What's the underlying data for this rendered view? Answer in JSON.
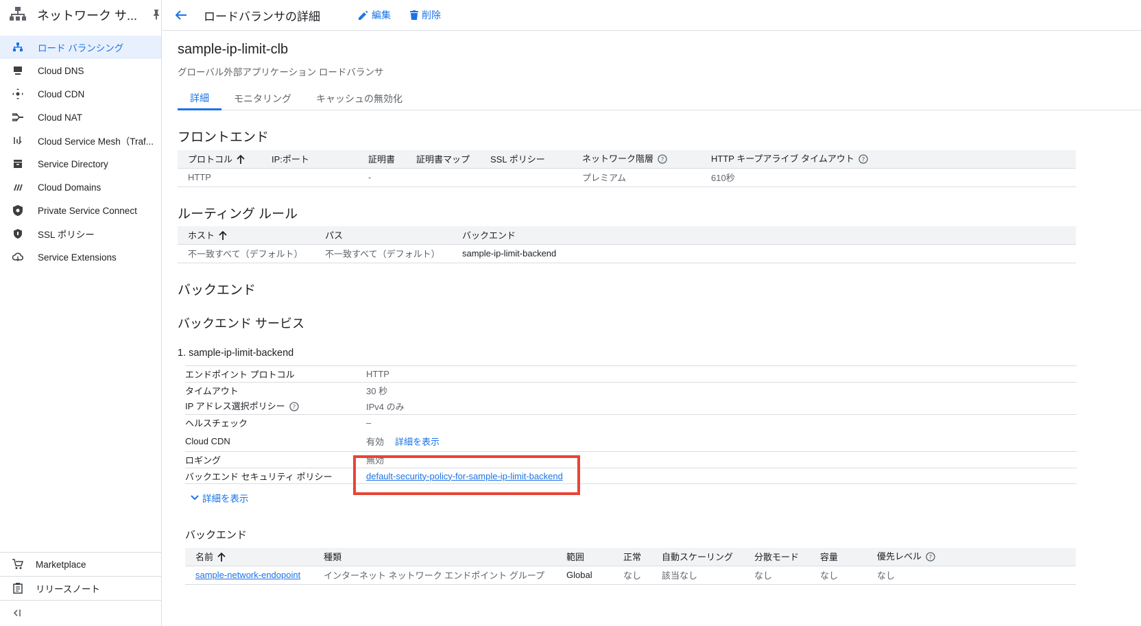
{
  "sidebar": {
    "title": "ネットワーク サ...",
    "items": [
      {
        "label": "ロード バランシング",
        "icon": "load-balancing-icon",
        "active": true
      },
      {
        "label": "Cloud DNS",
        "icon": "dns-icon"
      },
      {
        "label": "Cloud CDN",
        "icon": "cdn-icon"
      },
      {
        "label": "Cloud NAT",
        "icon": "nat-icon"
      },
      {
        "label": "Cloud Service Mesh（Traf...",
        "icon": "service-mesh-icon"
      },
      {
        "label": "Service Directory",
        "icon": "service-directory-icon"
      },
      {
        "label": "Cloud Domains",
        "icon": "domains-icon"
      },
      {
        "label": "Private Service Connect",
        "icon": "shield-icon"
      },
      {
        "label": "SSL ポリシー",
        "icon": "ssl-shield-icon"
      },
      {
        "label": "Service Extensions",
        "icon": "extensions-icon"
      }
    ],
    "bottom": [
      {
        "label": "Marketplace",
        "icon": "cart-icon"
      },
      {
        "label": "リリースノート",
        "icon": "notes-icon"
      }
    ]
  },
  "topbar": {
    "title": "ロードバランサの詳細",
    "edit_label": "編集",
    "delete_label": "削除"
  },
  "lb": {
    "name": "sample-ip-limit-clb",
    "type": "グローバル外部アプリケーション ロードバランサ"
  },
  "tabs": [
    "詳細",
    "モニタリング",
    "キャッシュの無効化"
  ],
  "frontend": {
    "heading": "フロントエンド",
    "headers": [
      "プロトコル",
      "IP:ポート",
      "証明書",
      "証明書マップ",
      "SSL ポリシー",
      "ネットワーク階層",
      "HTTP キープアライブ タイムアウト"
    ],
    "row": [
      "HTTP",
      "",
      "-",
      "",
      "",
      "プレミアム",
      "610秒"
    ]
  },
  "routing": {
    "heading": "ルーティング ルール",
    "headers": [
      "ホスト",
      "パス",
      "バックエンド"
    ],
    "row": [
      "不一致すべて（デフォルト）",
      "不一致すべて（デフォルト）",
      "sample-ip-limit-backend"
    ]
  },
  "backend": {
    "heading": "バックエンド",
    "services_heading": "バックエンド サービス",
    "service_title": "1. sample-ip-limit-backend",
    "props": {
      "endpoint_protocol_k": "エンドポイント プロトコル",
      "endpoint_protocol_v": "HTTP",
      "timeout_k": "タイムアウト",
      "timeout_v": "30 秒",
      "ip_policy_k": "IP アドレス選択ポリシー",
      "ip_policy_v": "IPv4 のみ",
      "health_k": "ヘルスチェック",
      "health_v": "–",
      "cdn_k": "Cloud CDN",
      "cdn_v": "有効",
      "cdn_link": "詳細を表示",
      "logging_k": "ロギング",
      "logging_v": "無効",
      "security_k": "バックエンド セキュリティ ポリシー",
      "security_v": "default-security-policy-for-sample-ip-limit-backend"
    },
    "show_details": "詳細を表示",
    "backends_heading": "バックエンド",
    "backends_headers": [
      "名前",
      "種類",
      "範囲",
      "正常",
      "自動スケーリング",
      "分散モード",
      "容量",
      "優先レベル"
    ],
    "backends_row": [
      "sample-network-endopoint",
      "インターネット ネットワーク エンドポイント グループ",
      "Global",
      "なし",
      "該当なし",
      "なし",
      "なし",
      "なし"
    ]
  }
}
